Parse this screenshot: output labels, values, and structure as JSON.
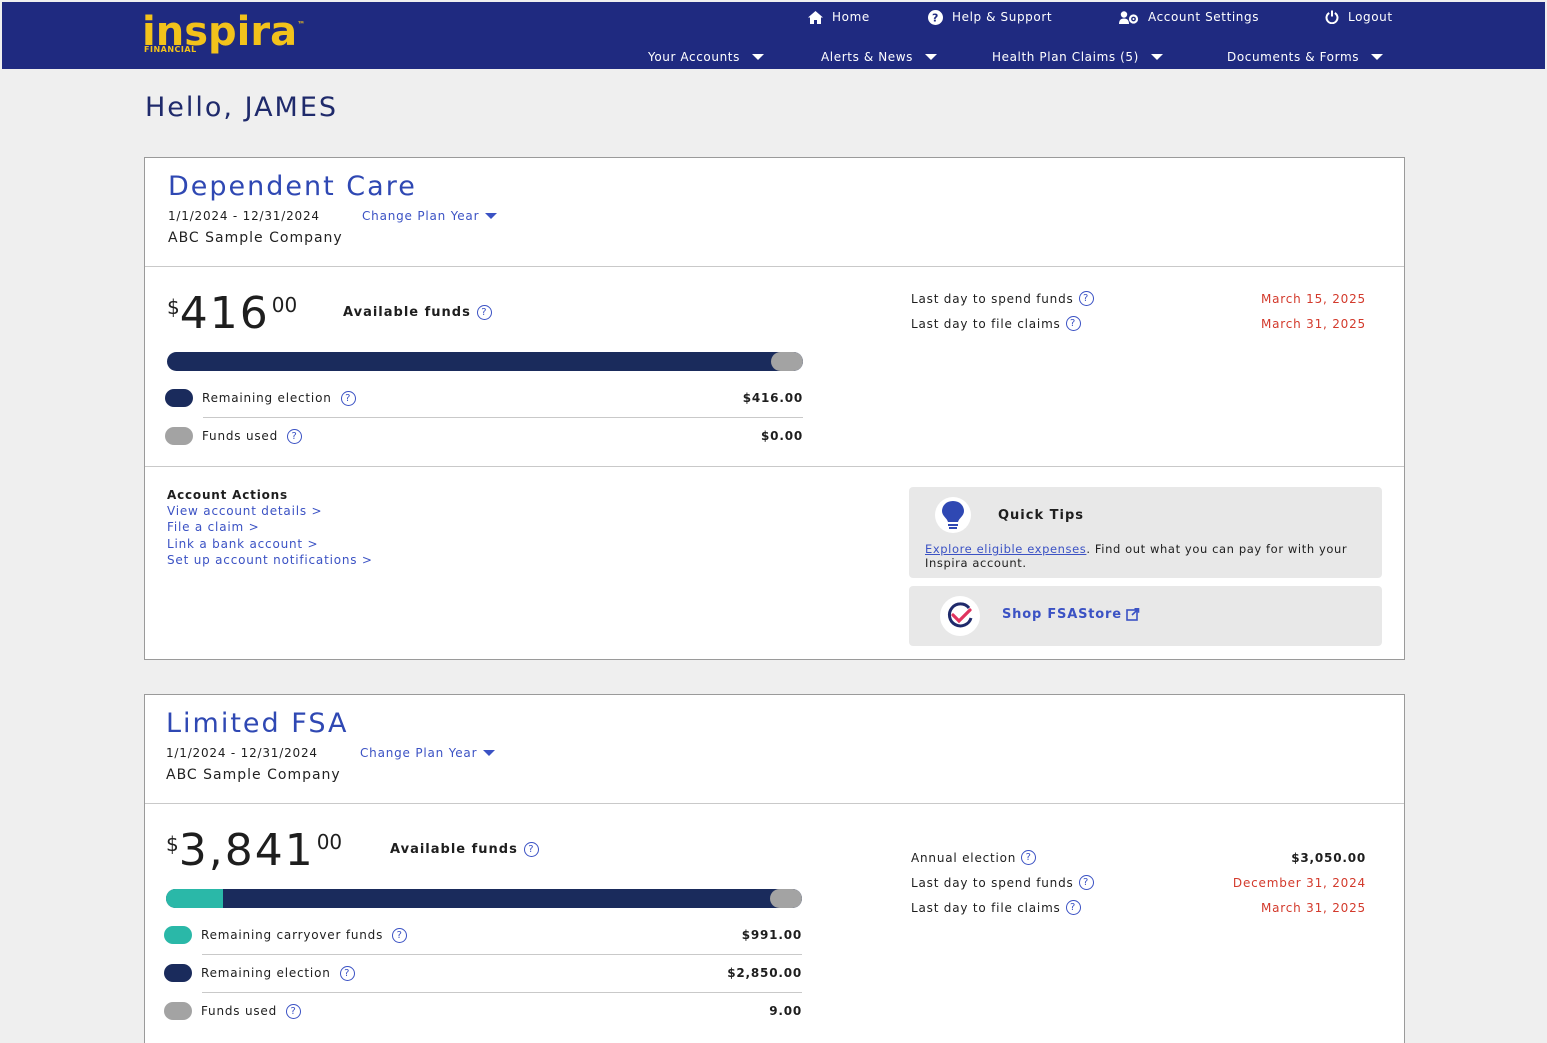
{
  "brand": {
    "name": "inspira",
    "tm": "™",
    "sub": "FINANCIAL"
  },
  "top_links": [
    {
      "label": "Home",
      "icon": "home-icon"
    },
    {
      "label": "Help & Support",
      "icon": "help-circle-icon"
    },
    {
      "label": "Account Settings",
      "icon": "user-gear-icon"
    },
    {
      "label": "Logout",
      "icon": "power-icon"
    }
  ],
  "main_nav": [
    {
      "label": "Your Accounts"
    },
    {
      "label": "Alerts & News"
    },
    {
      "label": "Health Plan Claims (5)"
    },
    {
      "label": "Documents & Forms"
    }
  ],
  "greeting": "Hello, JAMES",
  "dependent_care": {
    "title": "Dependent Care",
    "dates": "1/1/2024 - 12/31/2024",
    "change_plan_year": "Change Plan Year",
    "company": "ABC Sample Company",
    "currency": "$",
    "amount_whole": "416",
    "amount_cents": "00",
    "available_label": "Available funds",
    "bar": {
      "remaining_election_fraction": 0.95,
      "used_fraction": 0.05
    },
    "legend": [
      {
        "label": "Remaining election",
        "value": "$416.00",
        "color": "#1a2b5c"
      },
      {
        "label": "Funds used",
        "value": "$0.00",
        "color": "#a3a3a3"
      }
    ],
    "info": [
      {
        "label": "Last day to spend funds",
        "value": "March 15, 2025"
      },
      {
        "label": "Last day to file claims",
        "value": "March 31, 2025"
      }
    ],
    "actions_title": "Account Actions",
    "actions": [
      "View account details >",
      "File a claim >",
      "Link a bank account >",
      "Set up account notifications >"
    ],
    "quick_tips": {
      "title": "Quick Tips",
      "link": "Explore eligible expenses",
      "text": ". Find out what you can pay for with your Inspira account."
    },
    "shop": {
      "label": "Shop FSAStore"
    }
  },
  "limited_fsa": {
    "title": "Limited FSA",
    "dates": "1/1/2024 - 12/31/2024",
    "change_plan_year": "Change Plan Year",
    "company": "ABC Sample Company",
    "currency": "$",
    "amount_whole": "3,841",
    "amount_cents": "00",
    "available_label": "Available funds",
    "bar": {
      "carryover_fraction": 0.09,
      "remaining_election_fraction": 0.86,
      "used_fraction": 0.05
    },
    "legend": [
      {
        "label": "Remaining carryover funds",
        "value": "$991.00",
        "color": "#2ab8a8"
      },
      {
        "label": "Remaining election",
        "value": "$2,850.00",
        "color": "#1a2b5c"
      },
      {
        "label": "Funds used",
        "value": "9.00",
        "color": "#a3a3a3"
      }
    ],
    "info": [
      {
        "label": "Annual election",
        "value": "$3,050.00"
      },
      {
        "label": "Last day to spend funds",
        "value": "December 31, 2024"
      },
      {
        "label": "Last day to file claims",
        "value": "March 31, 2025"
      }
    ]
  },
  "colors": {
    "nav_bg": "#1f2a80",
    "brand_yellow": "#f2c21b",
    "link_blue": "#3b52c4",
    "alert_red": "#d33a2c",
    "bar_navy": "#1a2b5c",
    "carryover_teal": "#2ab8a8",
    "used_gray": "#a3a3a3"
  }
}
